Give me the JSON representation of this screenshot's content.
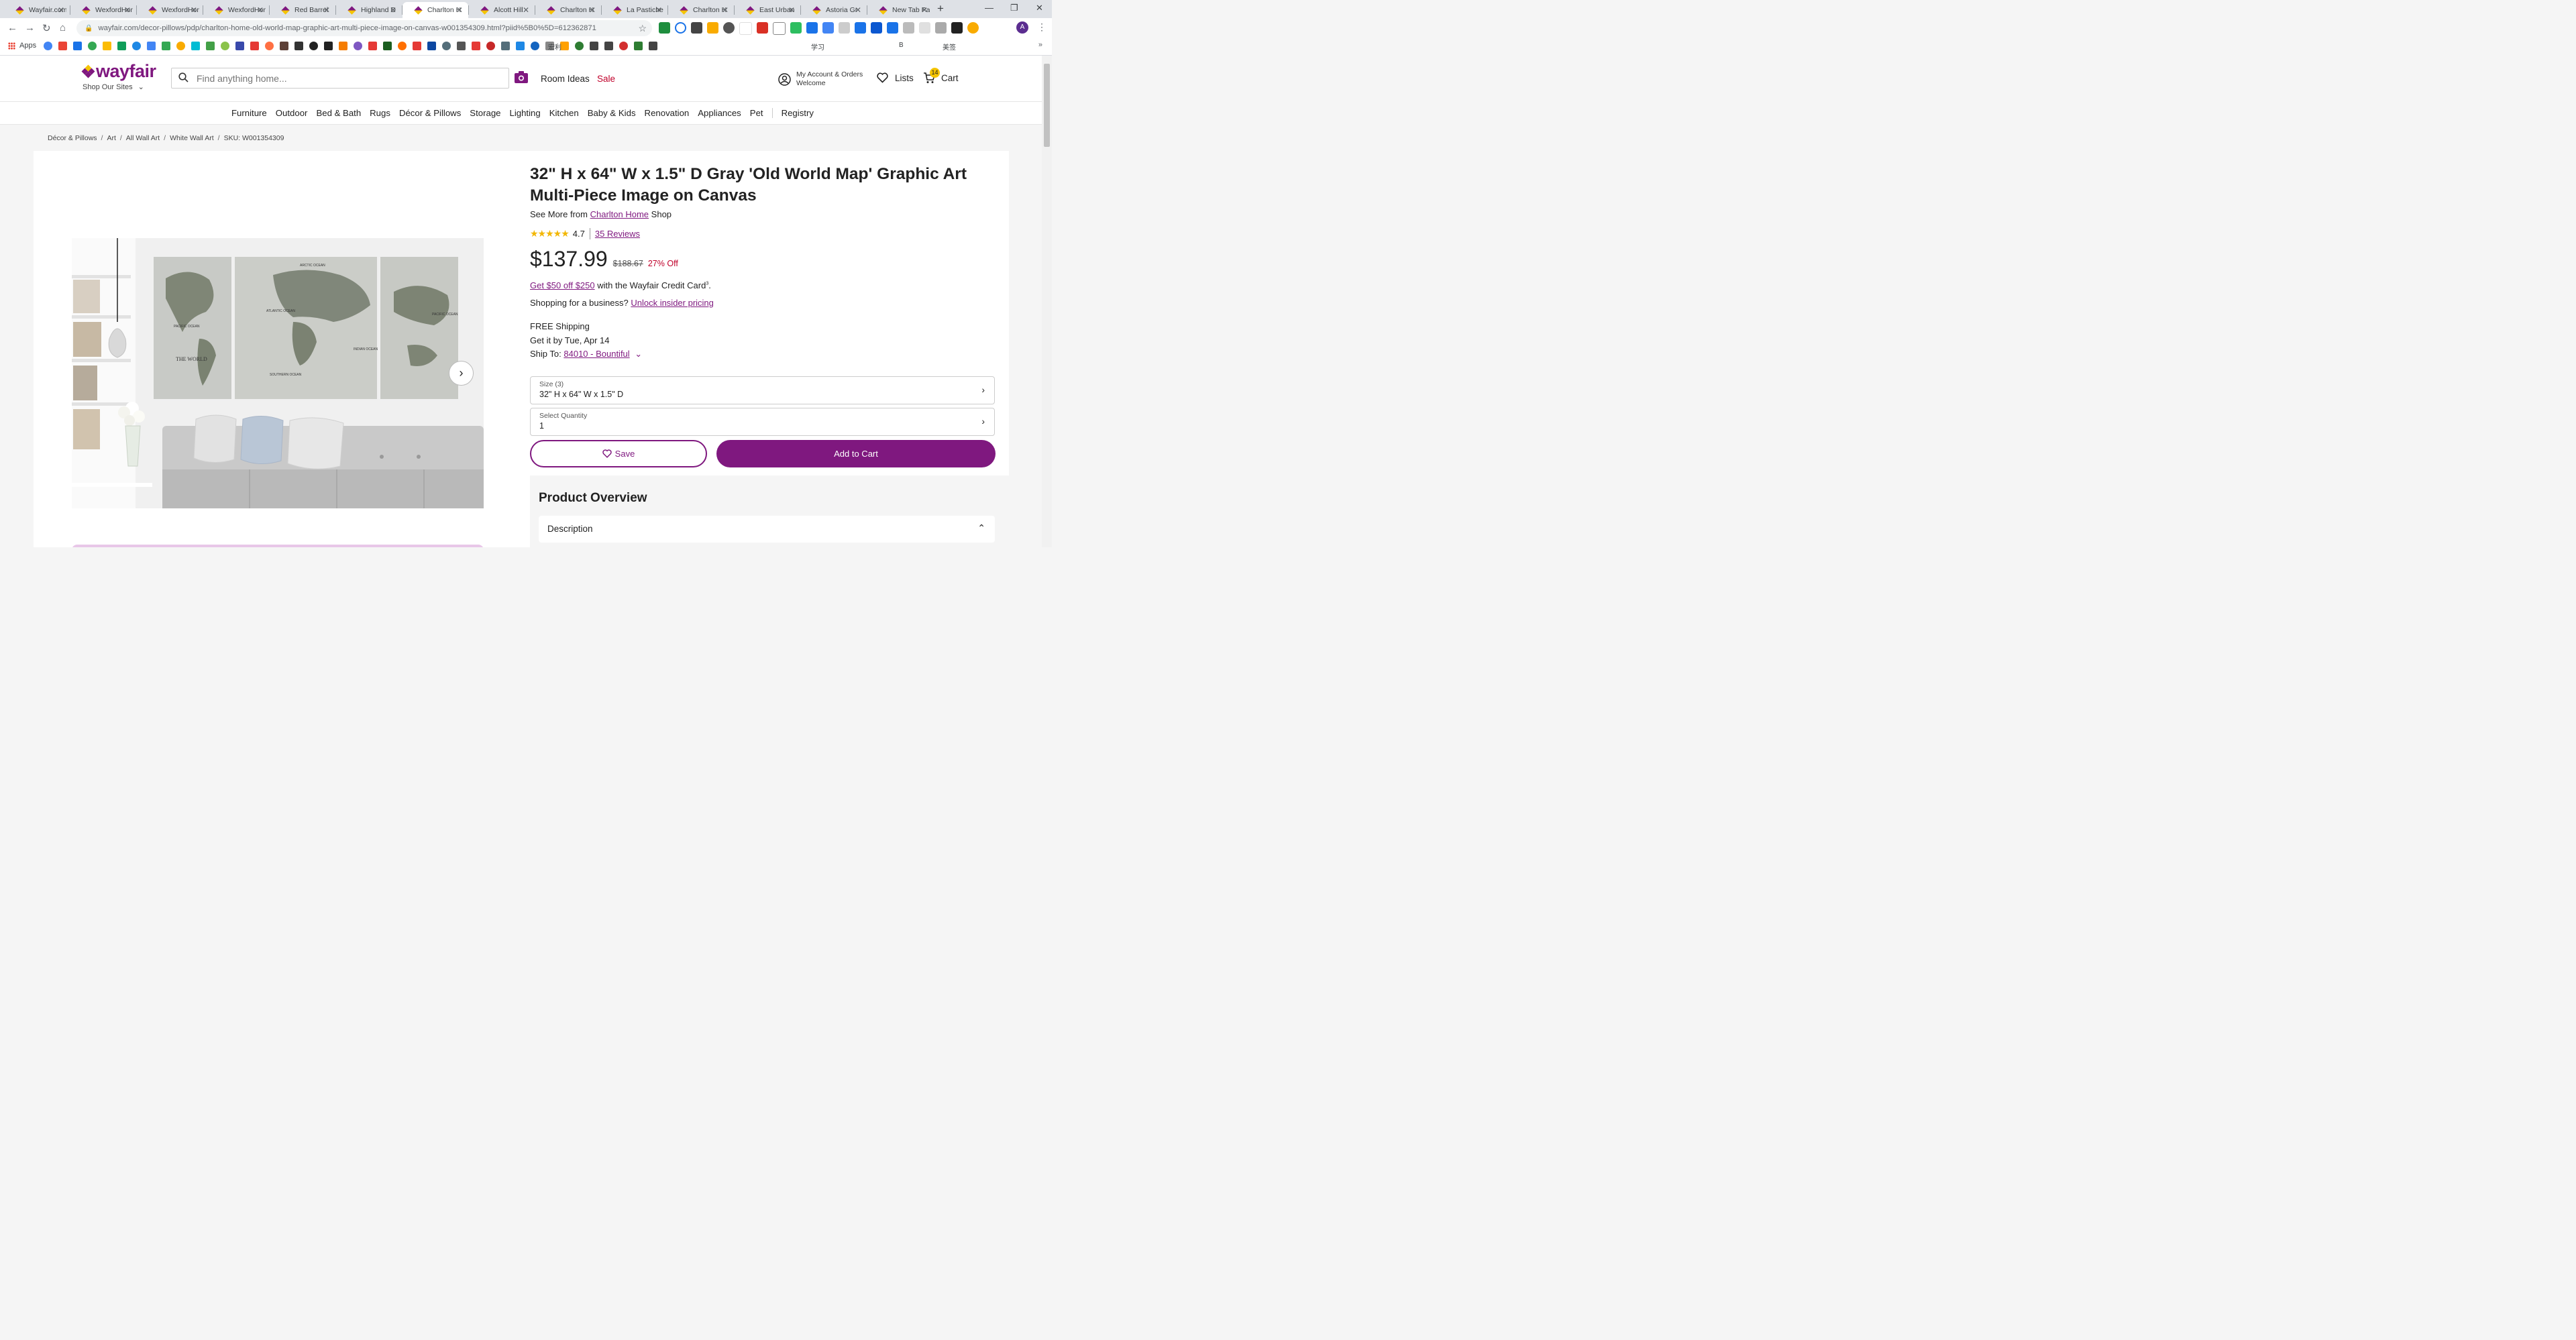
{
  "browser": {
    "tabs": [
      {
        "title": "Wayfair.com",
        "active": false
      },
      {
        "title": "WexfordHome",
        "active": false
      },
      {
        "title": "WexfordHome",
        "active": false
      },
      {
        "title": "WexfordHome",
        "active": false
      },
      {
        "title": "Red Barrel",
        "active": false
      },
      {
        "title": "Highland D",
        "active": false
      },
      {
        "title": "Charlton H",
        "active": true
      },
      {
        "title": "Alcott Hill",
        "active": false
      },
      {
        "title": "Charlton H",
        "active": false
      },
      {
        "title": "La Pastiche",
        "active": false
      },
      {
        "title": "Charlton H",
        "active": false
      },
      {
        "title": "East Urban",
        "active": false
      },
      {
        "title": "Astoria Gr",
        "active": false
      },
      {
        "title": "New Tab Page",
        "active": false
      }
    ],
    "url": "wayfair.com/decor-pillows/pdp/charlton-home-old-world-map-graphic-art-multi-piece-image-on-canvas-w001354309.html?piid%5B0%5D=612362871",
    "profile_initial": "A",
    "bookmarks_apps_label": "Apps",
    "bookmark_texts": {
      "b1": "宏利",
      "b2": "学习",
      "b3": "B",
      "b4": "美签"
    }
  },
  "header": {
    "logo_text": "wayfair",
    "shop_our_sites": "Shop Our Sites",
    "search_placeholder": "Find anything home...",
    "room_ideas": "Room Ideas",
    "sale": "Sale",
    "account_line1": "My Account & Orders",
    "account_line2": "Welcome",
    "lists": "Lists",
    "cart": "Cart",
    "cart_count": "14"
  },
  "categories": [
    "Furniture",
    "Outdoor",
    "Bed & Bath",
    "Rugs",
    "Décor & Pillows",
    "Storage",
    "Lighting",
    "Kitchen",
    "Baby & Kids",
    "Renovation",
    "Appliances",
    "Pet",
    "Registry"
  ],
  "breadcrumbs": [
    "Décor & Pillows",
    "Art",
    "All Wall Art",
    "White Wall Art",
    "SKU: W001354309"
  ],
  "product": {
    "title": "32\" H x 64\" W x 1.5\" D Gray 'Old World Map' Graphic Art Multi-Piece Image on Canvas",
    "see_more_prefix": "See More from",
    "brand": "Charlton Home",
    "see_more_suffix": "Shop",
    "rating": "4.7",
    "reviews": "35 Reviews",
    "price": "$137.99",
    "was_price": "$188.67",
    "discount": "27% Off",
    "credit_link": "Get $50 off $250",
    "credit_text": "with the Wayfair Credit Card",
    "credit_sup": "3",
    "business_text": "Shopping for a business?",
    "business_link": "Unlock insider pricing",
    "shipping": "FREE Shipping",
    "delivery": "Get it by Tue, Apr 14",
    "ship_to_label": "Ship To:",
    "ship_to_value": "84010 - Bountiful",
    "size_label": "Size (3)",
    "size_value": "32\" H x 64\" W x 1.5\" D",
    "qty_label": "Select Quantity",
    "qty_value": "1",
    "save": "Save",
    "add_to_cart": "Add to Cart",
    "overview_heading": "Product Overview",
    "description_label": "Description"
  },
  "image_labels": {
    "map_title": "THE WORLD",
    "arctic": "ARCTIC OCEAN",
    "atlantic": "ATLANTIC OCEAN",
    "pacific_left": "PACIFIC OCEAN",
    "pacific_right": "PACIFIC OCEAN",
    "indian": "INDIAN OCEAN",
    "southern": "SOUTHERN OCEAN"
  },
  "colors": {
    "brand": "#7f187f",
    "sale": "#c0002a",
    "stars": "#f2b705"
  }
}
